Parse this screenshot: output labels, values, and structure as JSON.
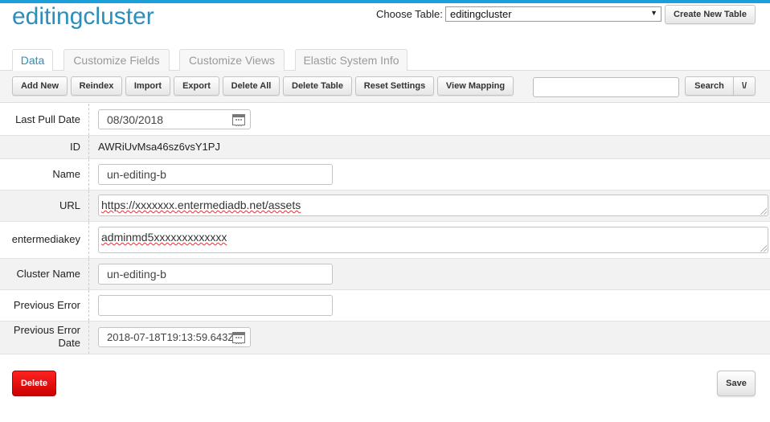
{
  "header": {
    "title": "editingcluster",
    "choose_table_label": "Choose Table:",
    "selected_table": "editingcluster",
    "create_table_label": "Create New Table"
  },
  "tabs": [
    {
      "label": "Data",
      "active": true
    },
    {
      "label": "Customize Fields",
      "active": false
    },
    {
      "label": "Customize Views",
      "active": false
    },
    {
      "label": "Elastic System Info",
      "active": false
    }
  ],
  "toolbar": {
    "buttons": [
      "Add New",
      "Reindex",
      "Import",
      "Export",
      "Delete All",
      "Delete Table",
      "Reset Settings",
      "View Mapping"
    ],
    "search_value": "",
    "search_label": "Search",
    "search_toggle": "\\/"
  },
  "fields": {
    "last_pull_date": {
      "label": "Last Pull Date",
      "value": "08/30/2018"
    },
    "id": {
      "label": "ID",
      "value": "AWRiUvMsa46sz6vsY1PJ"
    },
    "name": {
      "label": "Name",
      "value": "un-editing-b"
    },
    "url": {
      "label": "URL",
      "value": "https://xxxxxxx.entermediadb.net/assets"
    },
    "entermediakey": {
      "label": "entermediakey",
      "value": "adminmd5xxxxxxxxxxxxx"
    },
    "cluster_name": {
      "label": "Cluster Name",
      "value": "un-editing-b"
    },
    "previous_error": {
      "label": "Previous Error",
      "value": ""
    },
    "previous_error_date": {
      "label": "Previous Error Date",
      "value": "2018-07-18T19:13:59.643Z"
    }
  },
  "actions": {
    "delete_label": "Delete",
    "save_label": "Save"
  },
  "colors": {
    "accent": "#2a8fbd",
    "top_bar": "#1a9fd8",
    "delete_red": "#e00000"
  }
}
